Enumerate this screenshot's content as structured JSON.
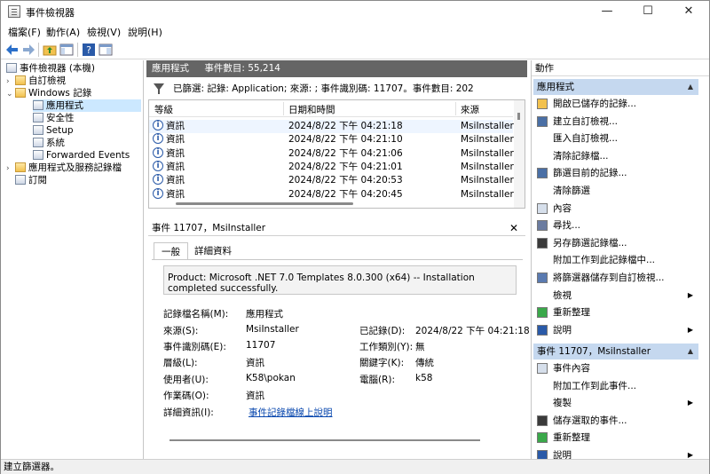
{
  "window": {
    "title": "事件檢視器",
    "minimize": "—",
    "maximize": "☐",
    "close": "✕"
  },
  "menu": [
    "檔案(F)",
    "動作(A)",
    "檢視(V)",
    "說明(H)"
  ],
  "tree": {
    "root": "事件檢視器 (本機)",
    "custom_views": "自訂檢視",
    "windows_logs": "Windows 記錄",
    "logs": [
      "應用程式",
      "安全性",
      "Setup",
      "系統",
      "Forwarded Events"
    ],
    "app_service_logs": "應用程式及服務記錄檔",
    "subscriptions": "訂閱"
  },
  "center": {
    "log_name": "應用程式",
    "event_count": "事件數目: 55,214",
    "filter_text": "已篩選: 記錄: Application; 來源: ; 事件識別碼: 11707。事件數目: 202",
    "columns": [
      "等級",
      "日期和時間",
      "來源"
    ],
    "rows": [
      {
        "level": "資訊",
        "datetime": "2024/8/22 下午 04:21:18",
        "source": "MsiInstaller"
      },
      {
        "level": "資訊",
        "datetime": "2024/8/22 下午 04:21:10",
        "source": "MsiInstaller"
      },
      {
        "level": "資訊",
        "datetime": "2024/8/22 下午 04:21:06",
        "source": "MsiInstaller"
      },
      {
        "level": "資訊",
        "datetime": "2024/8/22 下午 04:21:01",
        "source": "MsiInstaller"
      },
      {
        "level": "資訊",
        "datetime": "2024/8/22 下午 04:20:53",
        "source": "MsiInstaller"
      },
      {
        "level": "資訊",
        "datetime": "2024/8/22 下午 04:20:45",
        "source": "MsiInstaller"
      }
    ]
  },
  "detail": {
    "title": "事件 11707，MsiInstaller",
    "close": "✕",
    "tabs": [
      "一般",
      "詳細資料"
    ],
    "description": "Product: Microsoft .NET 7.0 Templates 8.0.300 (x64) -- Installation completed successfully.",
    "labels": {
      "log_name": "記錄檔名稱(M):",
      "source": "來源(S):",
      "event_id": "事件識別碼(E):",
      "level": "層級(L):",
      "user": "使用者(U):",
      "opcode": "作業碼(O):",
      "more_info": "詳細資訊(I):",
      "logged": "已記錄(D):",
      "task": "工作類別(Y):",
      "keywords": "關鍵字(K):",
      "computer": "電腦(R):"
    },
    "values": {
      "log_name": "應用程式",
      "source": "MsiInstaller",
      "event_id": "11707",
      "level": "資訊",
      "user": "K58\\pokan",
      "opcode": "資訊",
      "more_info": "事件記錄檔線上說明",
      "logged": "2024/8/22 下午 04:21:18",
      "task": "無",
      "keywords": "傳統",
      "computer": "k58"
    }
  },
  "actions": {
    "header": "動作",
    "section1": "應用程式",
    "items1": [
      "開啟已儲存的記錄...",
      "建立自訂檢視...",
      "匯入自訂檢視...",
      "清除記錄檔...",
      "篩選目前的記錄...",
      "清除篩選",
      "內容",
      "尋找...",
      "另存篩選記錄檔...",
      "附加工作到此記錄檔中...",
      "將篩選器儲存到自訂檢視...",
      "檢視",
      "重新整理",
      "說明"
    ],
    "section2": "事件 11707，MsiInstaller",
    "items2": [
      "事件內容",
      "附加工作到此事件...",
      "複製",
      "儲存選取的事件...",
      "重新整理",
      "說明"
    ]
  },
  "status": "建立篩選器。",
  "colors": {
    "header_bg": "#656565",
    "section_bg": "#c5d8ef",
    "selected_bg": "#cce8ff",
    "link": "#0645ad"
  }
}
